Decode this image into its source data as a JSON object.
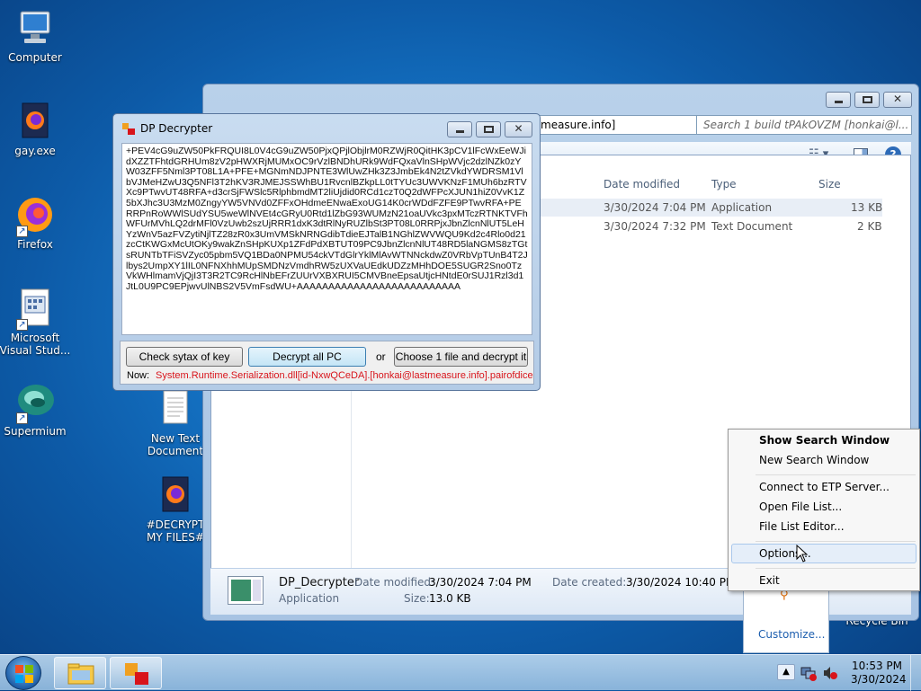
{
  "desktop": {
    "icons": [
      {
        "label": "Computer"
      },
      {
        "label": "gay.exe"
      },
      {
        "label": "Firefox"
      },
      {
        "label_line1": "Microsoft",
        "label_line2": "Visual Stud..."
      },
      {
        "label": "Supermium"
      },
      {
        "label_line1": "New Text",
        "label_line2": "Document"
      },
      {
        "label_line1": "#DECRYPT",
        "label_line2": "MY FILES#"
      },
      {
        "label": "Recycle Bin"
      }
    ]
  },
  "explorer": {
    "address_text": "measure.info]",
    "search_placeholder": "Search 1 build tPAkOVZM [honkai@l...",
    "columns": {
      "date": "Date modified",
      "type": "Type",
      "size": "Size"
    },
    "rows": [
      {
        "date": "3/30/2024 7:04 PM",
        "type": "Application",
        "size": "13 KB"
      },
      {
        "date": "3/30/2024 7:32 PM",
        "type": "Text Document",
        "size": "2 KB"
      }
    ],
    "details": {
      "name": "DP_Decrypter",
      "kind": "Application",
      "modified_label": "Date modified:",
      "modified_value": "3/30/2024 7:04 PM",
      "created_label": "Date created:",
      "created_value": "3/30/2024 10:40 PM",
      "size_label": "Size:",
      "size_value": "13.0 KB"
    }
  },
  "decrypter": {
    "title": "DP Decrypter",
    "key_text": "+PEV4cG9uZW50PkFRQUI8L0V4cG9uZW50PjxQPjlObjlrM0RZWjR0QitHK3pCV1lFcWxEeWJidXZZTFhtdGRHUm8zV2pHWXRjMUMxOC9rVzlBNDhURk9WdFQxaVlnSHpWVjc2dzlNZk0zYW03ZFF5Nml3PT08L1A+PFE+MGNmNDJPNTE3WlUwZHk3Z3JmbEk4N2tZVkdYWDRSM1VlbVJMeHZwU3Q5NFl3T2hKV3RJMEJSSWhBU1RvcnlBZkpLL0tTYUc3UWVKNzF1MUh6bzRTVXc9PTwvUT48RFA+d3crSjFWSlc5RlphbmdMT2liUjdid0RCd1czT0Q2dWFPcXJUN1hiZ0VvK1Z5bXJhc3U3MzM0ZngyYW5VNVd0ZFFxOHdmeENwaExoUG14K0crWDdFZFE9PTwvRFA+PERRPnRoWWlSUdYSU5weWlNVEt4cGRyU0Rtd1lZbG93WUMzN21oaUVkc3pxMTczRTNKTVFhWFUrMVhLQ2drMFl0VzUwb2szUjRRR1dxK3dtRlNyRUZlbSt3PT08L0RRPjxJbnZlcnNlUT5LeHYzWnV5azFVZytiNjlTZ28zR0x3UmVMSkNRNGdibTdieEJTalB1NGhlZWVWQU9Kd2c4Rlo0d21zcCtKWGxMcUtOKy9wakZnSHpKUXp1ZFdPdXBTUT09PC9JbnZlcnNlUT48RD5laNGMS8zTGtsRUNTbTFiSVZyc05pbm5VQ1BDa0NPMU54ckVTdGlrYklMlAvWTNNckdwZ0VRbVpTUnB4T2Jlbys2UmpXY1lIL0NFNXhhMUpSMDNzVmdhRW5zUXVaUEdkUDZzMHhDOE5SUGR2Sno0TzVkWHlmamVjQjI3T3R2TC9RcHlNbEFrZUUrVXBXRUI5CMVBneEpsaUtjcHNtdE0rSUJ1Rzl3d1JtL0U9PC9EPjwvUlNBS2V5VmFsdWU+AAAAAAAAAAAAAAAAAAAAAAAAAA",
    "btn_check": "Check sytax of key",
    "btn_decrypt_all": "Decrypt all PC",
    "or_text": "or",
    "btn_choose": "Choose 1 file and decrypt it",
    "now_label": "Now:",
    "now_value": "System.Runtime.Serialization.dll[id-NxwQCeDA].[honkai@lastmeasure.info].pairofdice"
  },
  "context_menu": {
    "items": [
      {
        "label": "Show Search Window"
      },
      {
        "label": "New Search Window"
      },
      {
        "label": "Connect to ETP Server..."
      },
      {
        "label": "Open File List..."
      },
      {
        "label": "File List Editor..."
      },
      {
        "label": "Options..."
      },
      {
        "label": "Exit"
      }
    ]
  },
  "tray_panel": {
    "customize": "Customize..."
  },
  "taskbar": {
    "time": "10:53 PM",
    "date": "3/30/2024"
  },
  "colors": {
    "accent": "#1e5faf",
    "status_red": "#d8141b"
  }
}
